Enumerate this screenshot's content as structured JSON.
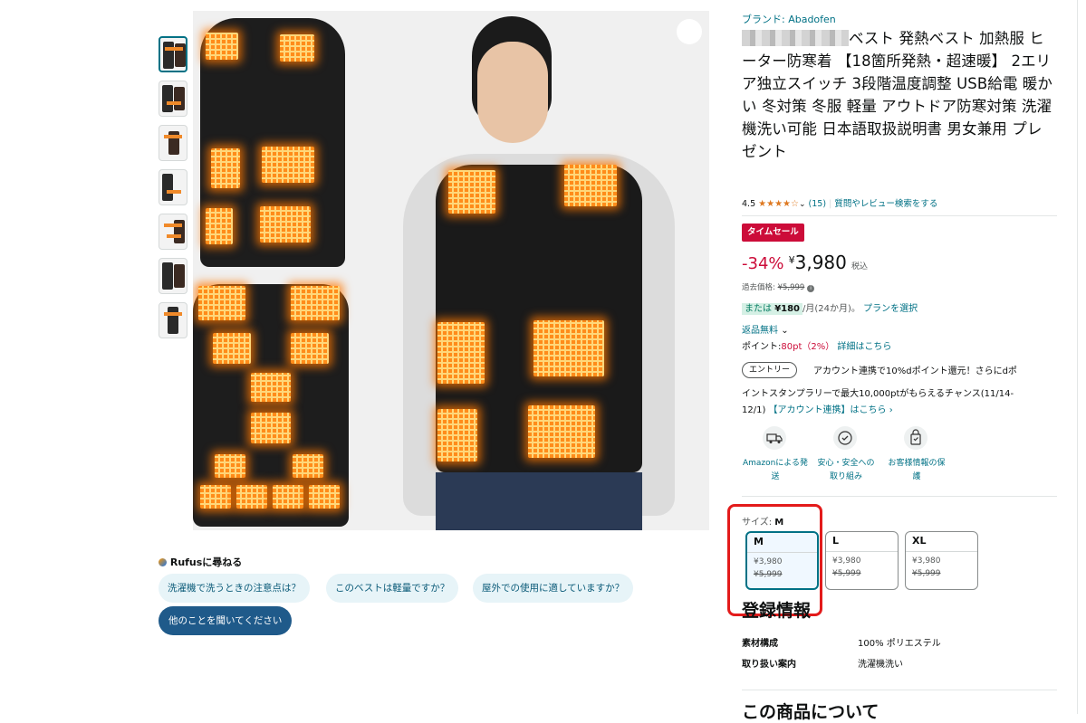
{
  "product": {
    "brand_link": "ブランド: Abadofen",
    "title_suffix": "ベスト 発熱ベスト 加熱服 ヒーター防寒着 【18箇所発熱・超速暖】 2エリア独立スイッチ 3段階温度調整 USB給電 暖かい 冬対策 冬服 軽量 アウトドア防寒対策 洗濯機洗い可能 日本語取扱説明書 男女兼用 プレゼント",
    "rating_value": "4.5",
    "stars": "★★★★☆",
    "rating_fraction": 0.9,
    "review_count": "(15)",
    "qa_link": "質問やレビュー検索をする"
  },
  "pricing": {
    "sale_badge": "タイムセール",
    "discount": "-34%",
    "currency": "¥",
    "price": "3,980",
    "tax": "税込",
    "list_label": "過去価格:",
    "list_price": "¥5,999",
    "installment_prefix": "または",
    "installment_amount": "¥180",
    "installment_suffix": "/月(24か月)。",
    "plan_link": "プランを選択",
    "returns": "返品無料",
    "points_label": "ポイント:",
    "points_value": "80pt（2%）",
    "points_link": "詳細はこちら"
  },
  "promo": {
    "entry_button": "エントリー",
    "text1": "アカウント連携で10%dポイント還元！さらにdポ",
    "text2": "イントスタンプラリーで最大10,000ptがもらえるチャンス(11/14-",
    "text3_prefix": "12/1)",
    "text3_link": "【アカウント連携】はこちら",
    "text3_chevron": "›"
  },
  "trust": [
    {
      "line1": "Amazonによる発",
      "line2": "送",
      "icon": "truck-icon"
    },
    {
      "line1": "安心・安全への",
      "line2": "取り組み",
      "icon": "shield-icon"
    },
    {
      "line1": "お客様情報の保",
      "line2": "護",
      "icon": "lock-icon"
    }
  ],
  "size": {
    "label": "サイズ:",
    "selected": "M",
    "options": [
      {
        "name": "M",
        "price": "¥3,980",
        "list": "¥5,999"
      },
      {
        "name": "L",
        "price": "¥3,980",
        "list": "¥5,999"
      },
      {
        "name": "XL",
        "price": "¥3,980",
        "list": "¥5,999"
      }
    ]
  },
  "registration": {
    "heading": "登録情報",
    "rows": [
      {
        "key": "素材構成",
        "value": "100% ポリエステル"
      },
      {
        "key": "取り扱い案内",
        "value": "洗濯機洗い"
      }
    ]
  },
  "about_heading": "この商品について",
  "rufus": {
    "title": "Rufusに尋ねる",
    "chips": [
      "洗濯機で洗うときの注意点は？",
      "このベストは軽量ですか？",
      "屋外での使用に適していますか？"
    ],
    "primary": "他のことを聞いてください"
  },
  "colors": {
    "link": "#007185",
    "sale_red": "#cc0c39",
    "highlight_red": "#e31b1b",
    "chip_bg": "#e7f4f8",
    "primary_chip": "#1f5a8a"
  }
}
